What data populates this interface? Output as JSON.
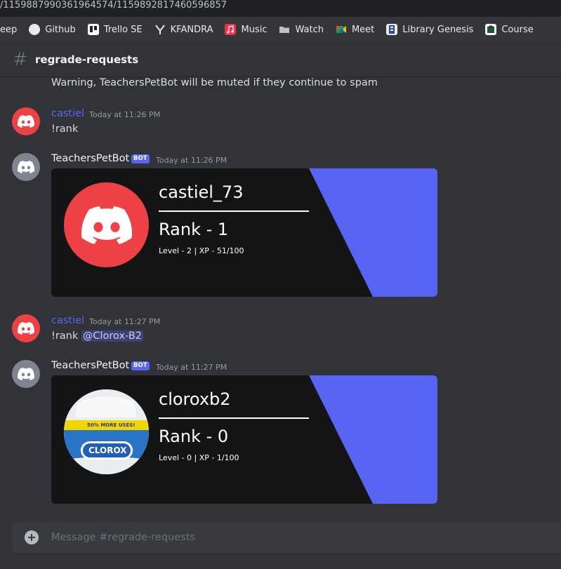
{
  "browser": {
    "url_fragment": "/1159887990361964574/1159892817460596857",
    "bookmarks": [
      {
        "label": "eep",
        "icon": "keep-icon"
      },
      {
        "label": "Github",
        "icon": "github-icon"
      },
      {
        "label": "Trello SE",
        "icon": "trello-icon"
      },
      {
        "label": "KFANDRA",
        "icon": "kfandra-icon"
      },
      {
        "label": "Music",
        "icon": "music-icon"
      },
      {
        "label": "Watch",
        "icon": "folder-icon"
      },
      {
        "label": "Meet",
        "icon": "meet-icon"
      },
      {
        "label": "Library Genesis",
        "icon": "library-icon"
      },
      {
        "label": "Course",
        "icon": "course-icon"
      }
    ]
  },
  "channel": {
    "hash": "#",
    "name": "regrade-requests"
  },
  "system_message": "Warning, TeachersPetBot will be muted if they continue to spam",
  "messages": [
    {
      "author": "castiel",
      "timestamp": "Today at 11:26 PM",
      "text": "!rank"
    },
    {
      "author": "TeachersPetBot",
      "bot_tag": "BOT",
      "timestamp": "Today at 11:26 PM",
      "card": {
        "username": "castiel_73",
        "rank": "Rank - 1",
        "level": "Level - 2 | XP - 51/100"
      }
    },
    {
      "author": "castiel",
      "timestamp": "Today at 11:27 PM",
      "text": "!rank",
      "mention": "@Clorox-B2"
    },
    {
      "author": "TeachersPetBot",
      "bot_tag": "BOT",
      "timestamp": "Today at 11:27 PM",
      "card": {
        "username": "cloroxb2",
        "rank": "Rank - 0",
        "level": "Level - 0 | XP - 1/100",
        "avatar_banner": "50% MORE USES!",
        "avatar_brand": "CLOROX"
      }
    }
  ],
  "composer": {
    "placeholder": "Message #regrade-requests"
  },
  "colors": {
    "accent": "#5865f2",
    "card_bg": "#141414",
    "red_avatar": "#ed4245"
  }
}
